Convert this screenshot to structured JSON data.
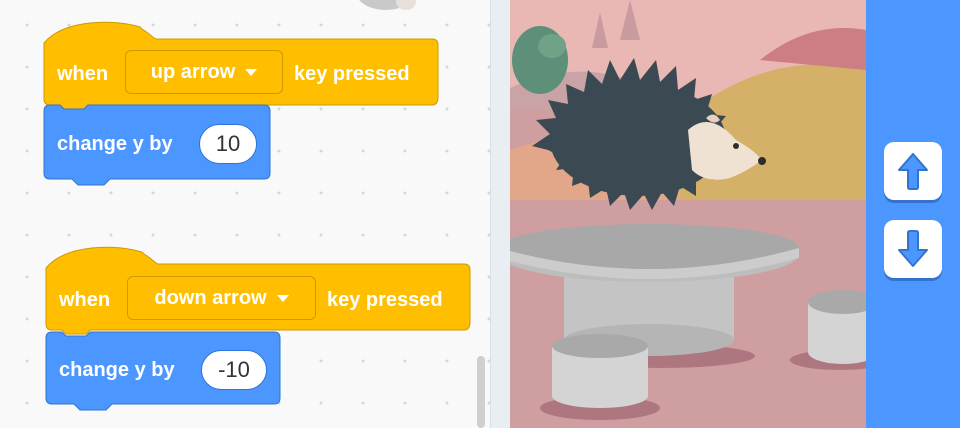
{
  "script1": {
    "hat": {
      "when": "when",
      "key": "up arrow",
      "pressed": "key pressed"
    },
    "motion": {
      "label": "change y by",
      "value": "10"
    }
  },
  "script2": {
    "hat": {
      "when": "when",
      "key": "down arrow",
      "pressed": "key pressed"
    },
    "motion": {
      "label": "change y by",
      "value": "-10"
    }
  },
  "controls": {
    "up_icon": "up-arrow-icon",
    "down_icon": "down-arrow-icon"
  },
  "colors": {
    "event_block": "#ffbf00",
    "motion_block": "#4c97ff",
    "control_panel": "#4c97ff",
    "stage_ground": "#cf9ea1"
  }
}
